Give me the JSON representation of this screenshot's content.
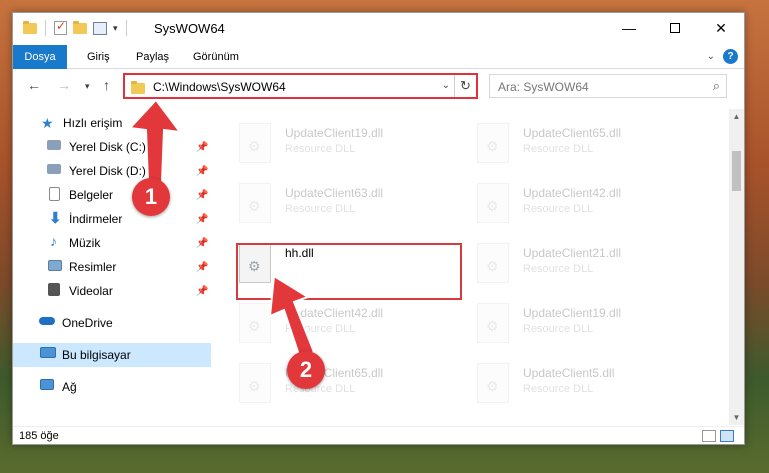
{
  "window": {
    "title": "SysWOW64"
  },
  "ribbon": {
    "tabs": [
      "Dosya",
      "Giriş",
      "Paylaş",
      "Görünüm"
    ]
  },
  "address": {
    "path": "C:\\Windows\\SysWOW64"
  },
  "search": {
    "placeholder": "Ara: SysWOW64"
  },
  "sidebar": {
    "items": [
      {
        "label": "Hızlı erişim",
        "icon": "star-icon",
        "pinned": false
      },
      {
        "label": "Yerel Disk (C:)",
        "icon": "drive-icon",
        "pinned": true
      },
      {
        "label": "Yerel Disk (D:)",
        "icon": "drive-icon",
        "pinned": true
      },
      {
        "label": "Belgeler",
        "icon": "documents-icon",
        "pinned": true
      },
      {
        "label": "İndirmeler",
        "icon": "download-icon",
        "pinned": true
      },
      {
        "label": "Müzik",
        "icon": "music-icon",
        "pinned": true
      },
      {
        "label": "Resimler",
        "icon": "pictures-icon",
        "pinned": true
      },
      {
        "label": "Videolar",
        "icon": "videos-icon",
        "pinned": true
      },
      {
        "label": "OneDrive",
        "icon": "cloud-icon",
        "pinned": false
      },
      {
        "label": "Bu bilgisayar",
        "icon": "computer-icon",
        "pinned": false,
        "selected": true
      },
      {
        "label": "Ağ",
        "icon": "network-icon",
        "pinned": false
      }
    ]
  },
  "files": {
    "left": [
      {
        "name": "UpdateClient19.dll",
        "type": "Resource DLL"
      },
      {
        "name": "UpdateClient63.dll",
        "type": "Resource DLL"
      },
      {
        "name": "hh.dll",
        "type": ""
      },
      {
        "name": "UpdateClient42.dll",
        "type": "Resource DLL"
      },
      {
        "name": "UpdateClient65.dll",
        "type": "Resource DLL"
      }
    ],
    "right": [
      {
        "name": "UpdateClient65.dll",
        "type": "Resource DLL"
      },
      {
        "name": "UpdateClient42.dll",
        "type": "Resource DLL"
      },
      {
        "name": "UpdateClient21.dll",
        "type": "Resource DLL"
      },
      {
        "name": "UpdateClient19.dll",
        "type": "Resource DLL"
      },
      {
        "name": "UpdateClient5.dll",
        "type": "Resource DLL"
      }
    ]
  },
  "status": {
    "count": "185 öğe"
  },
  "annotations": {
    "step1": "1",
    "step2": "2",
    "color": "#e2373b"
  }
}
